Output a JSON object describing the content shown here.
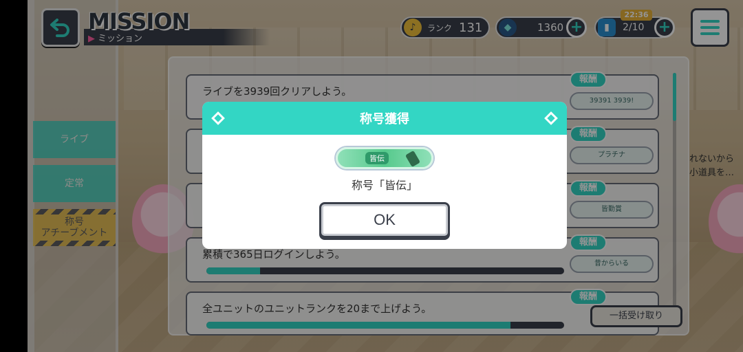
{
  "header": {
    "title": "MISSION",
    "subtitle": "ミッション"
  },
  "stats": {
    "rank_label": "ランク",
    "rank_value": "131",
    "crystals": "1360",
    "stamina": "2/10",
    "time": "22:36"
  },
  "side_tabs": [
    {
      "label": "ライブ"
    },
    {
      "label": "定常"
    },
    {
      "label": "称号\nアチーブメント"
    }
  ],
  "missions": [
    {
      "text": "ライブを3939回クリアしよう。",
      "reward_label": "報酬",
      "reward_item": "39391 3939!"
    },
    {
      "text": "",
      "reward_label": "報酬",
      "reward_item": "プラチナ"
    },
    {
      "text": "",
      "reward_label": "報酬",
      "reward_item": "皆勤賞"
    },
    {
      "text": "累積で365日ログインしよう。",
      "reward_label": "報酬",
      "reward_item": "昔からいる",
      "progress": 0.15
    },
    {
      "text": "全ユニットのユニットランクを20まで上げよう。",
      "reward_label": "報酬",
      "reward_item": "",
      "progress": 0.85
    }
  ],
  "claim_all_label": "一括受け取り",
  "bg_text": "れないから\n小道具を…",
  "modal": {
    "title": "称号獲得",
    "badge_text": "皆伝",
    "message": "称号「皆伝」",
    "ok_label": "OK"
  },
  "colors": {
    "accent": "#33d6c4",
    "dark": "#3a3f4a"
  }
}
